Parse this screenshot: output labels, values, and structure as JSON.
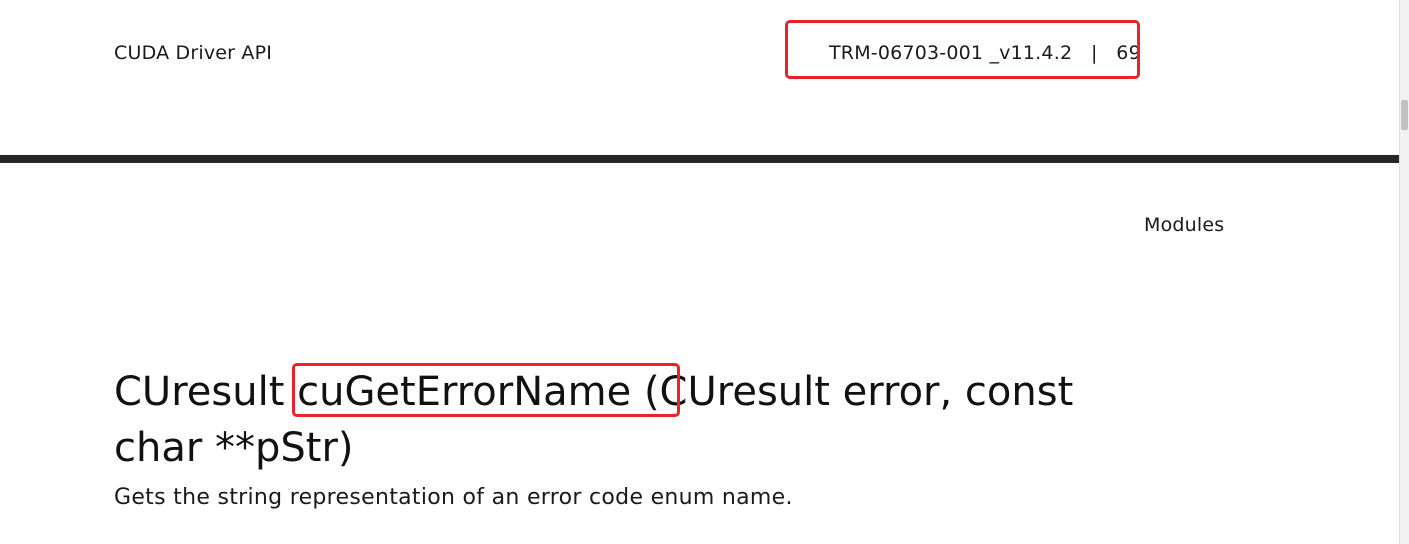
{
  "header": {
    "doc_title": "CUDA Driver API",
    "doc_id": "TRM-06703-001 _v11.4.2",
    "separator": "|",
    "page_number": "69"
  },
  "section": {
    "label": "Modules"
  },
  "function": {
    "return_type": "CUresult",
    "name": "cuGetErrorName",
    "params": "(CUresult error, const char **pStr)",
    "description": "Gets the string representation of an error code enum name."
  },
  "annotations": {
    "color": "#e8232a"
  },
  "colors": {
    "divider": "#262626",
    "text": "#1a1a1a"
  }
}
